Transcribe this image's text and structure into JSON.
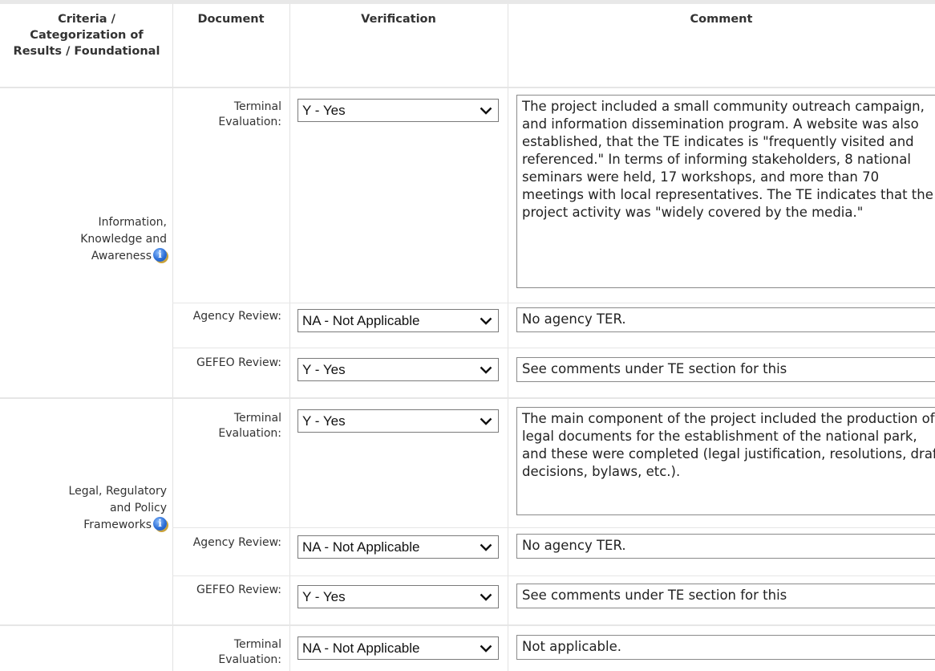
{
  "header": {
    "criteria": "Criteria / Categorization of Results / Foundational",
    "document": "Document",
    "verification": "Verification",
    "comment": "Comment"
  },
  "criteria": {
    "info_knowledge": "Information, Knowledge and Awareness",
    "legal_regulatory": "Legal, Regulatory and Policy Frameworks"
  },
  "documents": {
    "terminal_evaluation": "Terminal Evaluation:",
    "agency_review": "Agency Review:",
    "gefeo_review": "GEFEO Review:"
  },
  "rows": [
    {
      "verification": "Y - Yes",
      "comment": "The project included a small community outreach campaign, and information dissemination program. A website was also established, that the TE indicates is \"frequently visited and referenced.\" In terms of informing stakeholders, 8 national seminars were held, 17 workshops, and more than 70 meetings with local representatives. The TE indicates that the project activity was \"widely covered by the media.\""
    },
    {
      "verification": "NA - Not Applicable",
      "comment": "No agency TER."
    },
    {
      "verification": "Y - Yes",
      "comment": "See comments under TE section for this"
    },
    {
      "verification": "Y - Yes",
      "comment": "The main component of the project included the production of legal documents for the establishment of the national park, and these were completed (legal justification, resolutions, draft decisions, bylaws, etc.)."
    },
    {
      "verification": "NA - Not Applicable",
      "comment": "No agency TER."
    },
    {
      "verification": "Y - Yes",
      "comment": "See comments under TE section for this"
    },
    {
      "verification": "NA - Not Applicable",
      "comment": "Not applicable."
    }
  ],
  "icons": {
    "info": "info-icon",
    "dropdown": "chevron-down-icon"
  },
  "colors": {
    "icon_blue": "#2d6fd6",
    "border": "#7a7a7a",
    "grid": "#e2e2e2"
  }
}
